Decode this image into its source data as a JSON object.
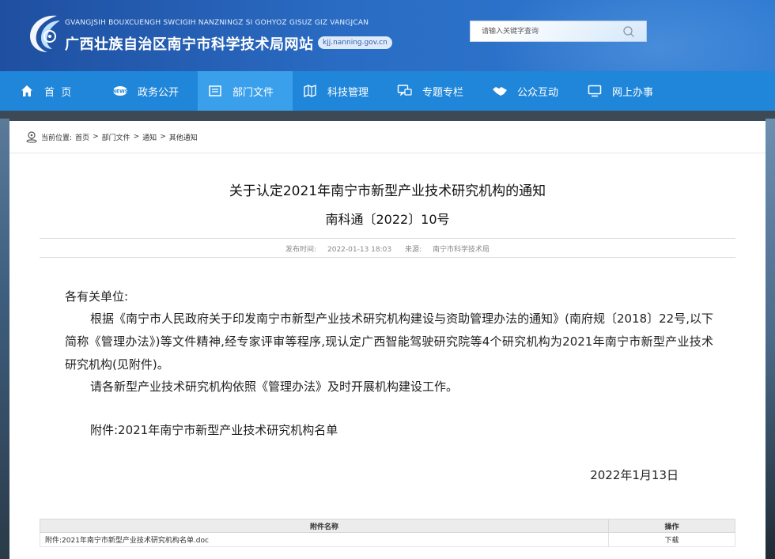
{
  "header": {
    "pinyin": "GVANGJSIH BOUXCUENGH SWCIGIH NANZNINGZ SI GOHYOZ GISUZ GIZ VANGJCAN",
    "title": "广西壮族自治区南宁市科学技术局网站",
    "domain": "kjj.nanning.gov.cn",
    "search_placeholder": "请输入关键字查询"
  },
  "nav": {
    "items": [
      {
        "label": "首  页",
        "icon": "home-icon"
      },
      {
        "label": "政务公开",
        "icon": "news-icon"
      },
      {
        "label": "部门文件",
        "icon": "document-icon"
      },
      {
        "label": "科技管理",
        "icon": "map-icon"
      },
      {
        "label": "专题专栏",
        "icon": "chat-icon"
      },
      {
        "label": "公众互动",
        "icon": "handshake-icon"
      },
      {
        "label": "网上办事",
        "icon": "monitor-icon"
      }
    ],
    "active_index": 2
  },
  "breadcrumb": {
    "prefix": "当前位置:",
    "items": [
      "首页",
      "部门文件",
      "通知",
      "其他通知"
    ],
    "sep": ">"
  },
  "article": {
    "title": "关于认定2021年南宁市新型产业技术研究机构的通知",
    "doc_no": "南科通〔2022〕10号",
    "publish_label": "发布时间:",
    "publish_time": "2022-01-13 18:03",
    "source_label": "来源:",
    "source": "南宁市科学技术局",
    "greeting": "各有关单位:",
    "para1": "根据《南宁市人民政府关于印发南宁市新型产业技术研究机构建设与资助管理办法的通知》(南府规〔2018〕22号,以下简称《管理办法》)等文件精神,经专家评审等程序,现认定广西智能驾驶研究院等4个研究机构为2021年南宁市新型产业技术研究机构(见附件)。",
    "para2": "请各新型产业技术研究机构依照《管理办法》及时开展机构建设工作。",
    "attachment_line": "附件:2021年南宁市新型产业技术研究机构名单",
    "date": "2022年1月13日"
  },
  "attachments": {
    "header_name": "附件名称",
    "header_op": "操作",
    "rows": [
      {
        "name": "附件:2021年南宁市新型产业技术研究机构名单.doc",
        "op": "下载"
      }
    ]
  },
  "colors": {
    "header_bg": "#2a6cc4",
    "nav_bg": "#1f86da",
    "nav_active": "#3aa0ec"
  }
}
